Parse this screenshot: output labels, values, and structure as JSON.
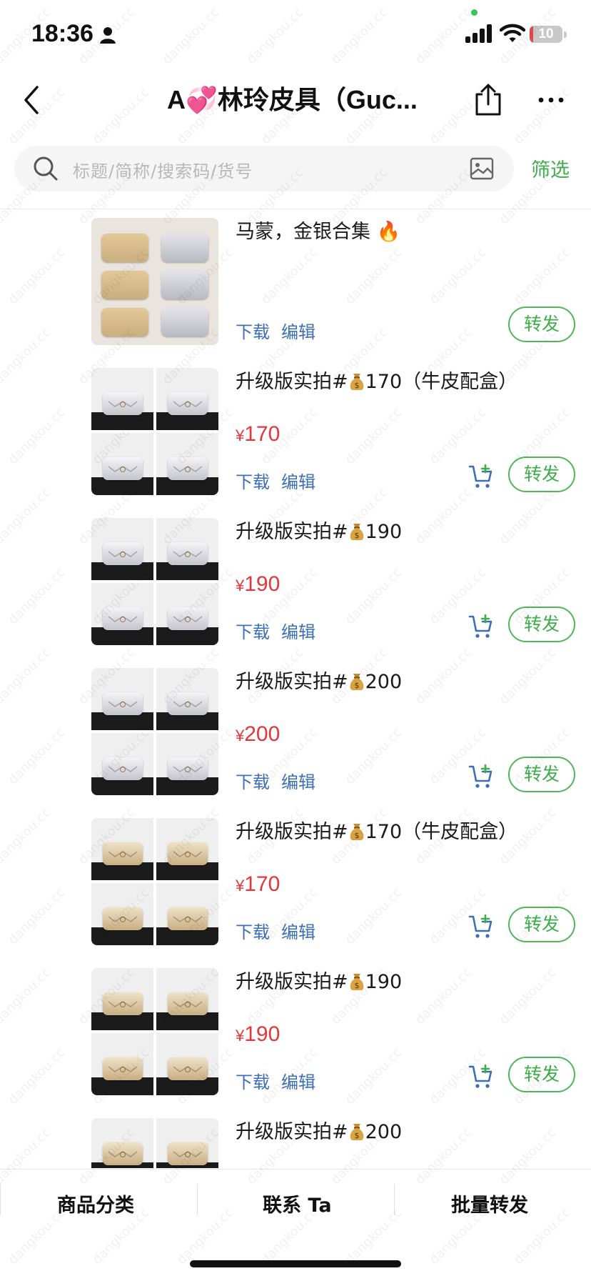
{
  "status_bar": {
    "time": "18:36",
    "battery": "10",
    "battery_level": 0.1
  },
  "nav": {
    "title": "A💞林玲皮具（Guc..."
  },
  "search": {
    "placeholder": "标题/简称/搜索码/货号",
    "filter_label": "筛选"
  },
  "items": [
    {
      "title": "马蒙，金银合集 🔥",
      "price": "",
      "has_cart": false,
      "style": "single",
      "download": "下载",
      "edit": "编辑",
      "forward": "转发"
    },
    {
      "title_prefix": "升级版实拍#",
      "title_suffix": "170（牛皮配盒）",
      "currency": "¥",
      "price": "170",
      "has_cart": true,
      "style": "silver",
      "download": "下载",
      "edit": "编辑",
      "forward": "转发"
    },
    {
      "title_prefix": "升级版实拍#",
      "title_suffix": "190",
      "currency": "¥",
      "price": "190",
      "has_cart": true,
      "style": "silver",
      "download": "下载",
      "edit": "编辑",
      "forward": "转发"
    },
    {
      "title_prefix": "升级版实拍#",
      "title_suffix": "200",
      "currency": "¥",
      "price": "200",
      "has_cart": true,
      "style": "silver",
      "download": "下载",
      "edit": "编辑",
      "forward": "转发"
    },
    {
      "title_prefix": "升级版实拍#",
      "title_suffix": "170（牛皮配盒）",
      "currency": "¥",
      "price": "170",
      "has_cart": true,
      "style": "gold",
      "download": "下载",
      "edit": "编辑",
      "forward": "转发"
    },
    {
      "title_prefix": "升级版实拍#",
      "title_suffix": "190",
      "currency": "¥",
      "price": "190",
      "has_cart": true,
      "style": "gold",
      "download": "下载",
      "edit": "编辑",
      "forward": "转发"
    },
    {
      "title_prefix": "升级版实拍#",
      "title_suffix": "200",
      "currency": "",
      "price": "",
      "has_cart": false,
      "style": "gold",
      "download": "",
      "edit": "",
      "forward": ""
    }
  ],
  "tabbar": {
    "category": "商品分类",
    "contact": "联系 Ta",
    "batch_forward": "批量转发"
  },
  "watermark": "dangkou.cc",
  "colors": {
    "accent_green": "#3dae4a",
    "price_red": "#e2373b",
    "link_blue": "#3d6fb5"
  }
}
